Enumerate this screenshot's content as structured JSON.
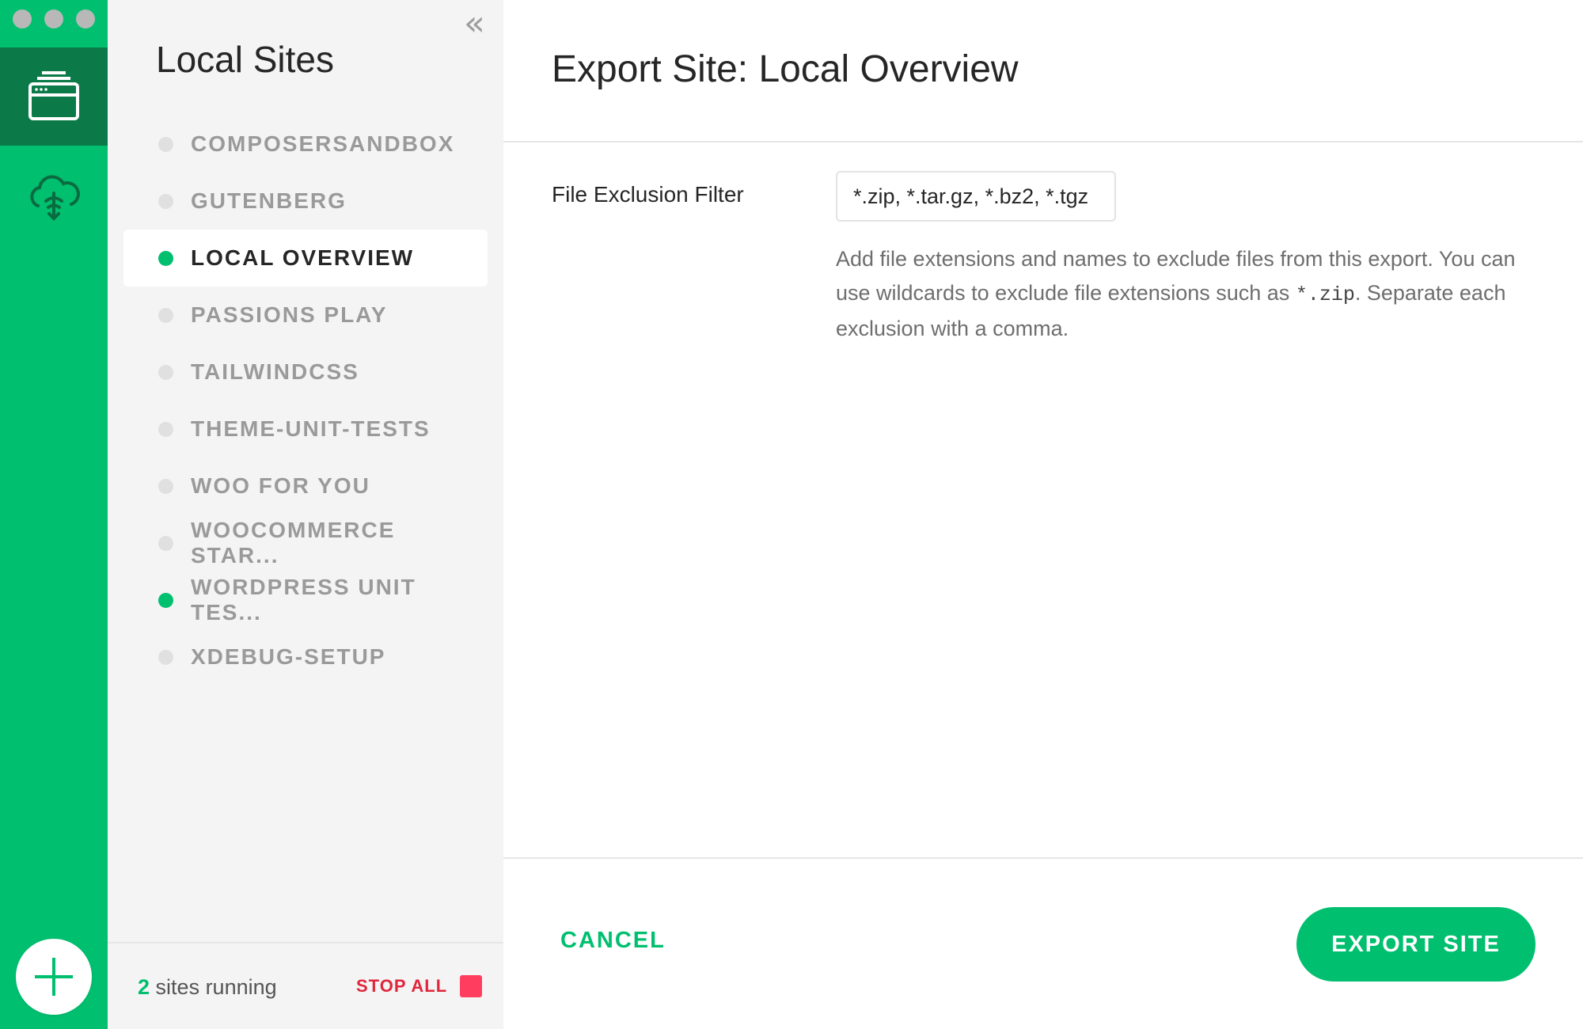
{
  "sidebar": {
    "title": "Local Sites",
    "collapse_icon": "«",
    "sites": [
      {
        "name": "COMPOSERSANDBOX",
        "running": false,
        "active": false
      },
      {
        "name": "GUTENBERG",
        "running": false,
        "active": false
      },
      {
        "name": "LOCAL OVERVIEW",
        "running": true,
        "active": true
      },
      {
        "name": "PASSIONS PLAY",
        "running": false,
        "active": false
      },
      {
        "name": "TAILWINDCSS",
        "running": false,
        "active": false
      },
      {
        "name": "THEME-UNIT-TESTS",
        "running": false,
        "active": false
      },
      {
        "name": "WOO FOR YOU",
        "running": false,
        "active": false
      },
      {
        "name": "WOOCOMMERCE STAR...",
        "running": false,
        "active": false
      },
      {
        "name": "WORDPRESS UNIT TES...",
        "running": true,
        "active": false
      },
      {
        "name": "XDEBUG-SETUP",
        "running": false,
        "active": false
      }
    ],
    "footer": {
      "running_count": "2",
      "running_label": "sites running",
      "stop_all_label": "STOP ALL"
    }
  },
  "main": {
    "title": "Export Site: Local Overview",
    "field_label": "File Exclusion Filter",
    "field_value": "*.zip, *.tar.gz, *.bz2, *.tgz",
    "help_part1": "Add file extensions and names to exclude files from this export. You can use wildcards to exclude file extensions such as ",
    "help_code": "*.zip",
    "help_part2": ". Separate each exclusion with a comma.",
    "cancel_label": "CANCEL",
    "export_label": "EXPORT SITE"
  },
  "colors": {
    "brand_green": "#00bf6f",
    "rail_active": "#0b7a48",
    "stop_red": "#e0263c"
  }
}
